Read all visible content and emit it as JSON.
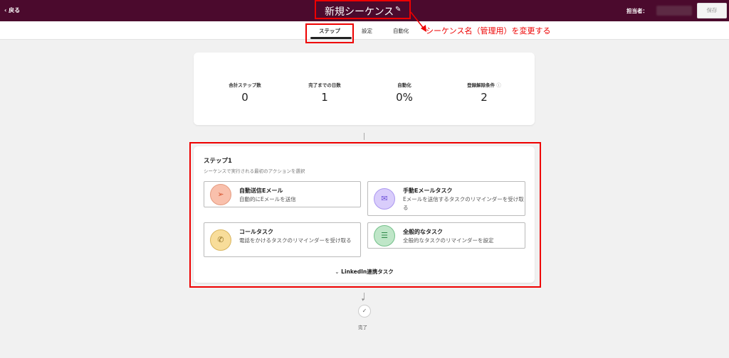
{
  "header": {
    "back_label": "戻る",
    "title": "新規シーケンス",
    "owner_label": "担当者：",
    "save_label": "保存"
  },
  "tabs": [
    {
      "label": "ステップ"
    },
    {
      "label": "設定"
    },
    {
      "label": "自動化"
    }
  ],
  "summary": [
    {
      "label": "合計ステップ数",
      "value": "0"
    },
    {
      "label": "完了までの日数",
      "value": "1"
    },
    {
      "label": "自動化",
      "value": "0%"
    },
    {
      "label": "登録解除条件",
      "value": "2"
    }
  ],
  "step": {
    "title": "ステップ1",
    "subtitle": "シーケンスで実行される最初のアクションを選択",
    "options": [
      {
        "title": "自動送信Eメール",
        "desc": "自動的にEメールを送信",
        "color": "#f9c0ac"
      },
      {
        "title": "手動Eメールタスク",
        "desc": "Eメールを送信するタスクのリマインダーを受け取る",
        "color": "#d9cdfb"
      },
      {
        "title": "コールタスク",
        "desc": "電話をかけるタスクのリマインダーを受け取る",
        "color": "#f8dd9a"
      },
      {
        "title": "全般的なタスク",
        "desc": "全般的なタスクのリマインダーを設定",
        "color": "#bfe6c8"
      }
    ],
    "linkedin_label": "LinkedIn連携タスク"
  },
  "end": {
    "label": "完了"
  },
  "annotation": {
    "text": "シーケンス名（管理用）を変更する"
  }
}
